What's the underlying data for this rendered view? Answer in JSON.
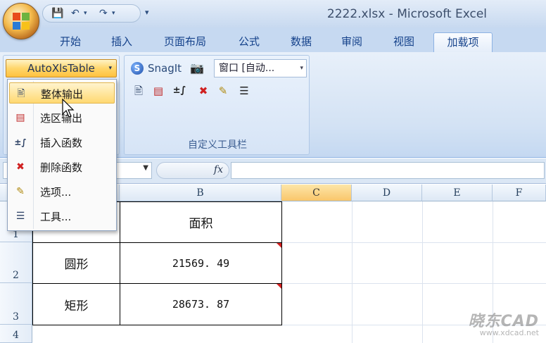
{
  "window": {
    "title": "2222.xlsx - Microsoft Excel"
  },
  "ribbon_tabs": [
    {
      "label": "开始"
    },
    {
      "label": "插入"
    },
    {
      "label": "页面布局"
    },
    {
      "label": "公式"
    },
    {
      "label": "数据"
    },
    {
      "label": "审阅"
    },
    {
      "label": "视图"
    },
    {
      "label": "加载项"
    }
  ],
  "addins": {
    "autoxls_label": "AutoXlsTable",
    "snagit_label": "SnagIt",
    "window_select_value": "窗口 [自动...",
    "toolbar_group_label": "自定义工具栏"
  },
  "menu": {
    "items": [
      {
        "label": "整体输出",
        "icon": "export-all-icon"
      },
      {
        "label": "选区输出",
        "icon": "export-selection-icon"
      },
      {
        "label": "插入函数",
        "icon": "insert-function-icon"
      },
      {
        "label": "删除函数",
        "icon": "delete-function-icon"
      },
      {
        "label": "选项...",
        "icon": "options-icon"
      },
      {
        "label": "工具...",
        "icon": "tools-icon"
      }
    ]
  },
  "formula_bar": {
    "fx": "fx"
  },
  "sheet": {
    "columns": [
      "B",
      "C",
      "D",
      "E",
      "F"
    ],
    "rows": [
      "1",
      "2",
      "3",
      "4"
    ],
    "cells": {
      "b1": "面积",
      "a2": "圆形",
      "b2": "21569. 49",
      "a3": "矩形",
      "b3": "28673. 87"
    }
  },
  "watermark": {
    "logo": "晓东CAD",
    "url": "www.xdcad.net"
  },
  "colors": {
    "accent": "#ffd66b",
    "ribbon": "#d3e2f4",
    "selected_header": "#f9c66b"
  }
}
